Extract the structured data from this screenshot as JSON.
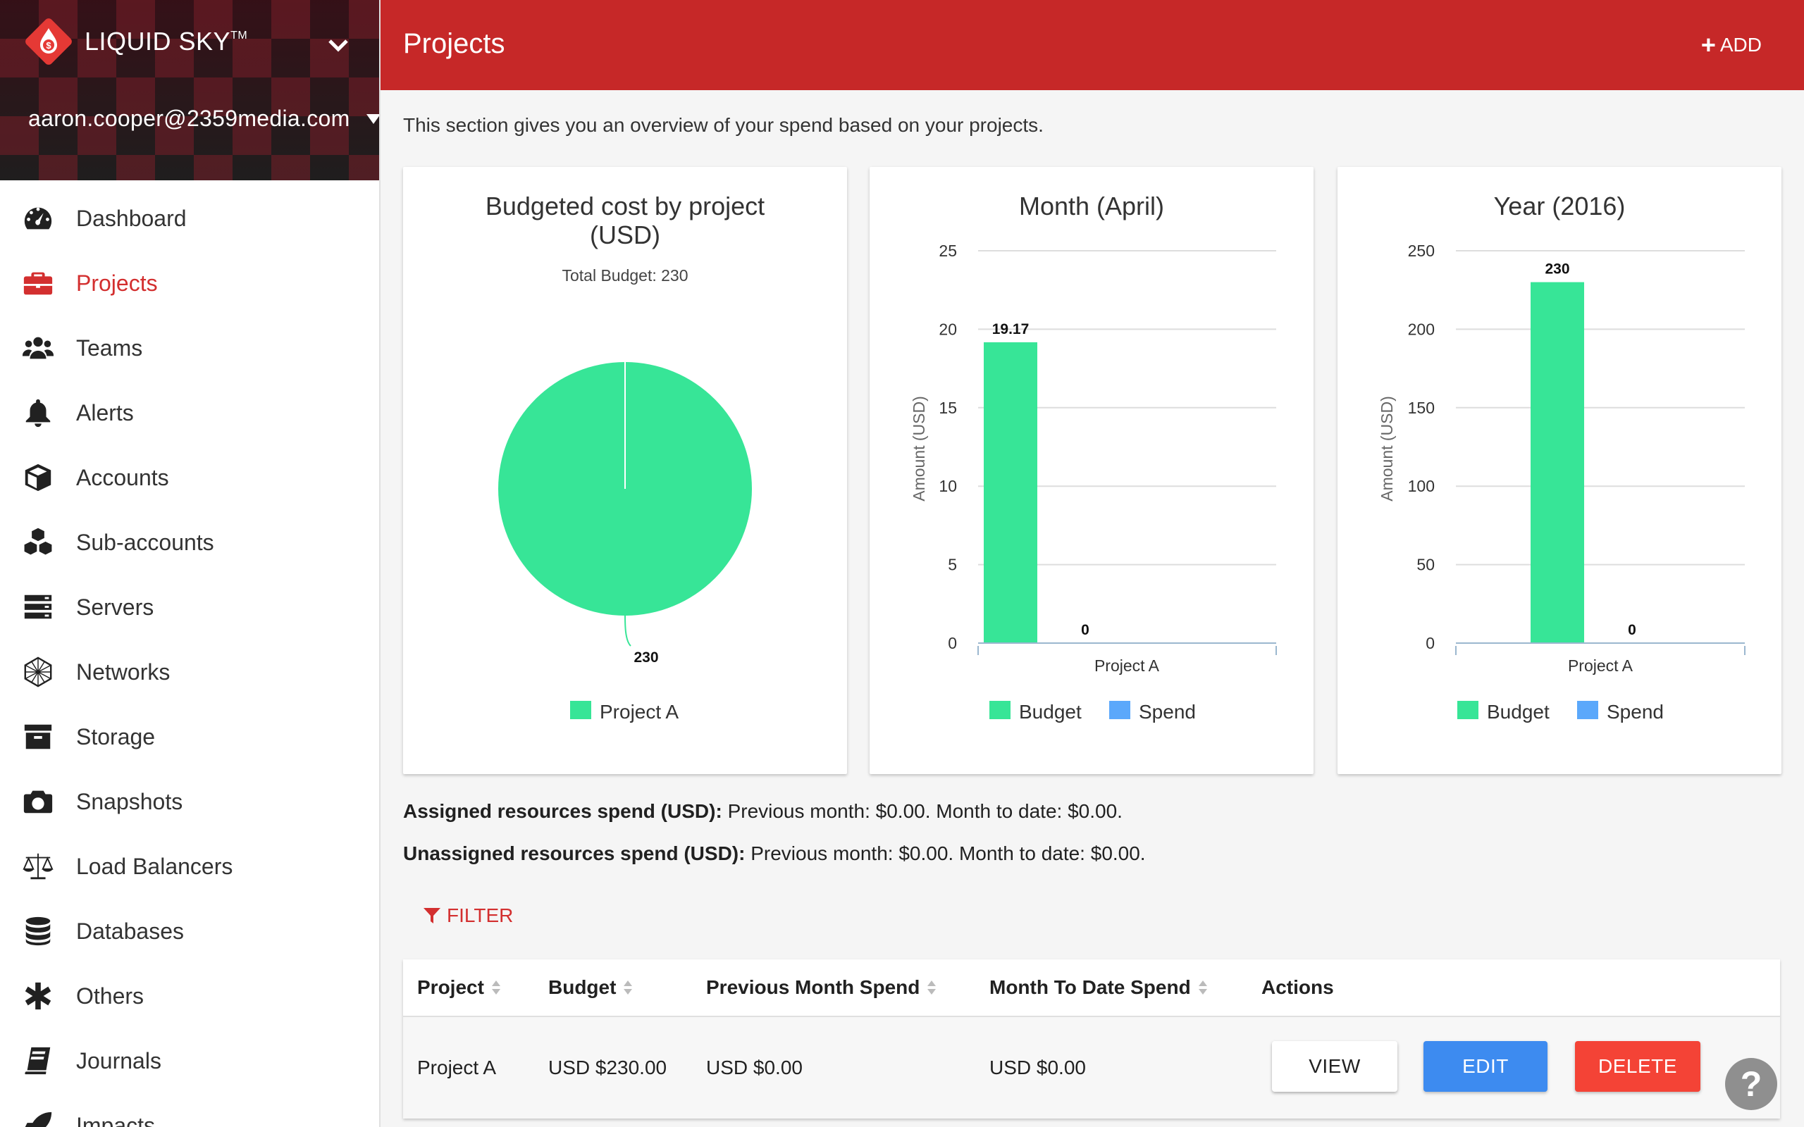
{
  "brand": {
    "name": "LIQUID SKY",
    "trademark": "TM"
  },
  "user": {
    "email": "aaron.cooper@2359media.com"
  },
  "nav": {
    "items": [
      {
        "label": "Dashboard",
        "icon": "dashboard-icon"
      },
      {
        "label": "Projects",
        "icon": "briefcase-icon",
        "active": true
      },
      {
        "label": "Teams",
        "icon": "users-icon"
      },
      {
        "label": "Alerts",
        "icon": "bell-icon"
      },
      {
        "label": "Accounts",
        "icon": "cube-icon"
      },
      {
        "label": "Sub-accounts",
        "icon": "cubes-icon"
      },
      {
        "label": "Servers",
        "icon": "server-icon"
      },
      {
        "label": "Networks",
        "icon": "network-icon"
      },
      {
        "label": "Storage",
        "icon": "archive-icon"
      },
      {
        "label": "Snapshots",
        "icon": "camera-icon"
      },
      {
        "label": "Load Balancers",
        "icon": "balance-scale-icon"
      },
      {
        "label": "Databases",
        "icon": "database-icon"
      },
      {
        "label": "Others",
        "icon": "asterisk-icon"
      },
      {
        "label": "Journals",
        "icon": "book-icon"
      },
      {
        "label": "Impacts",
        "icon": "rocket-icon"
      }
    ]
  },
  "header": {
    "title": "Projects",
    "add_label": "ADD"
  },
  "intro": "This section gives you an overview of your spend based on your projects.",
  "colors": {
    "accent": "#c62828",
    "budget": "#37e597",
    "spend": "#5ba8fb",
    "edit": "#3d8bf0",
    "delete": "#f44336"
  },
  "chart_data": [
    {
      "type": "pie",
      "title_line1": "Budgeted cost by project",
      "title_line2": "(USD)",
      "subtitle": "Total Budget: 230",
      "categories": [
        "Project A"
      ],
      "values": [
        230
      ],
      "value_labels": [
        "230"
      ],
      "legend": [
        "Project A"
      ]
    },
    {
      "type": "bar",
      "title": "Month (April)",
      "ylabel": "Amount (USD)",
      "categories": [
        "Project A"
      ],
      "ylim": [
        0,
        25
      ],
      "yticks": [
        "0",
        "5",
        "10",
        "15",
        "20",
        "25"
      ],
      "series": [
        {
          "name": "Budget",
          "values": [
            19.17
          ],
          "label": "19.17"
        },
        {
          "name": "Spend",
          "values": [
            0
          ],
          "label": "0"
        }
      ],
      "legend_position": "bottom"
    },
    {
      "type": "bar",
      "title": "Year (2016)",
      "ylabel": "Amount (USD)",
      "categories": [
        "Project A"
      ],
      "ylim": [
        0,
        250
      ],
      "yticks": [
        "0",
        "50",
        "100",
        "150",
        "200",
        "250"
      ],
      "series": [
        {
          "name": "Budget",
          "values": [
            230
          ],
          "label": "230"
        },
        {
          "name": "Spend",
          "values": [
            0
          ],
          "label": "0"
        }
      ],
      "legend_position": "bottom"
    }
  ],
  "spend": {
    "assigned_label": "Assigned resources spend (USD):",
    "assigned_text": "Previous month: $0.00. Month to date: $0.00.",
    "unassigned_label": "Unassigned resources spend (USD):",
    "unassigned_text": "Previous month: $0.00. Month to date: $0.00."
  },
  "filter_label": "FILTER",
  "table": {
    "columns": [
      "Project",
      "Budget",
      "Previous Month Spend",
      "Month To Date Spend",
      "Actions"
    ],
    "rows": [
      {
        "project": "Project A",
        "budget": "USD $230.00",
        "prev_spend": "USD $0.00",
        "mtd_spend": "USD $0.00"
      }
    ],
    "actions": {
      "view": "VIEW",
      "edit": "EDIT",
      "delete": "DELETE"
    }
  },
  "help_label": "?"
}
